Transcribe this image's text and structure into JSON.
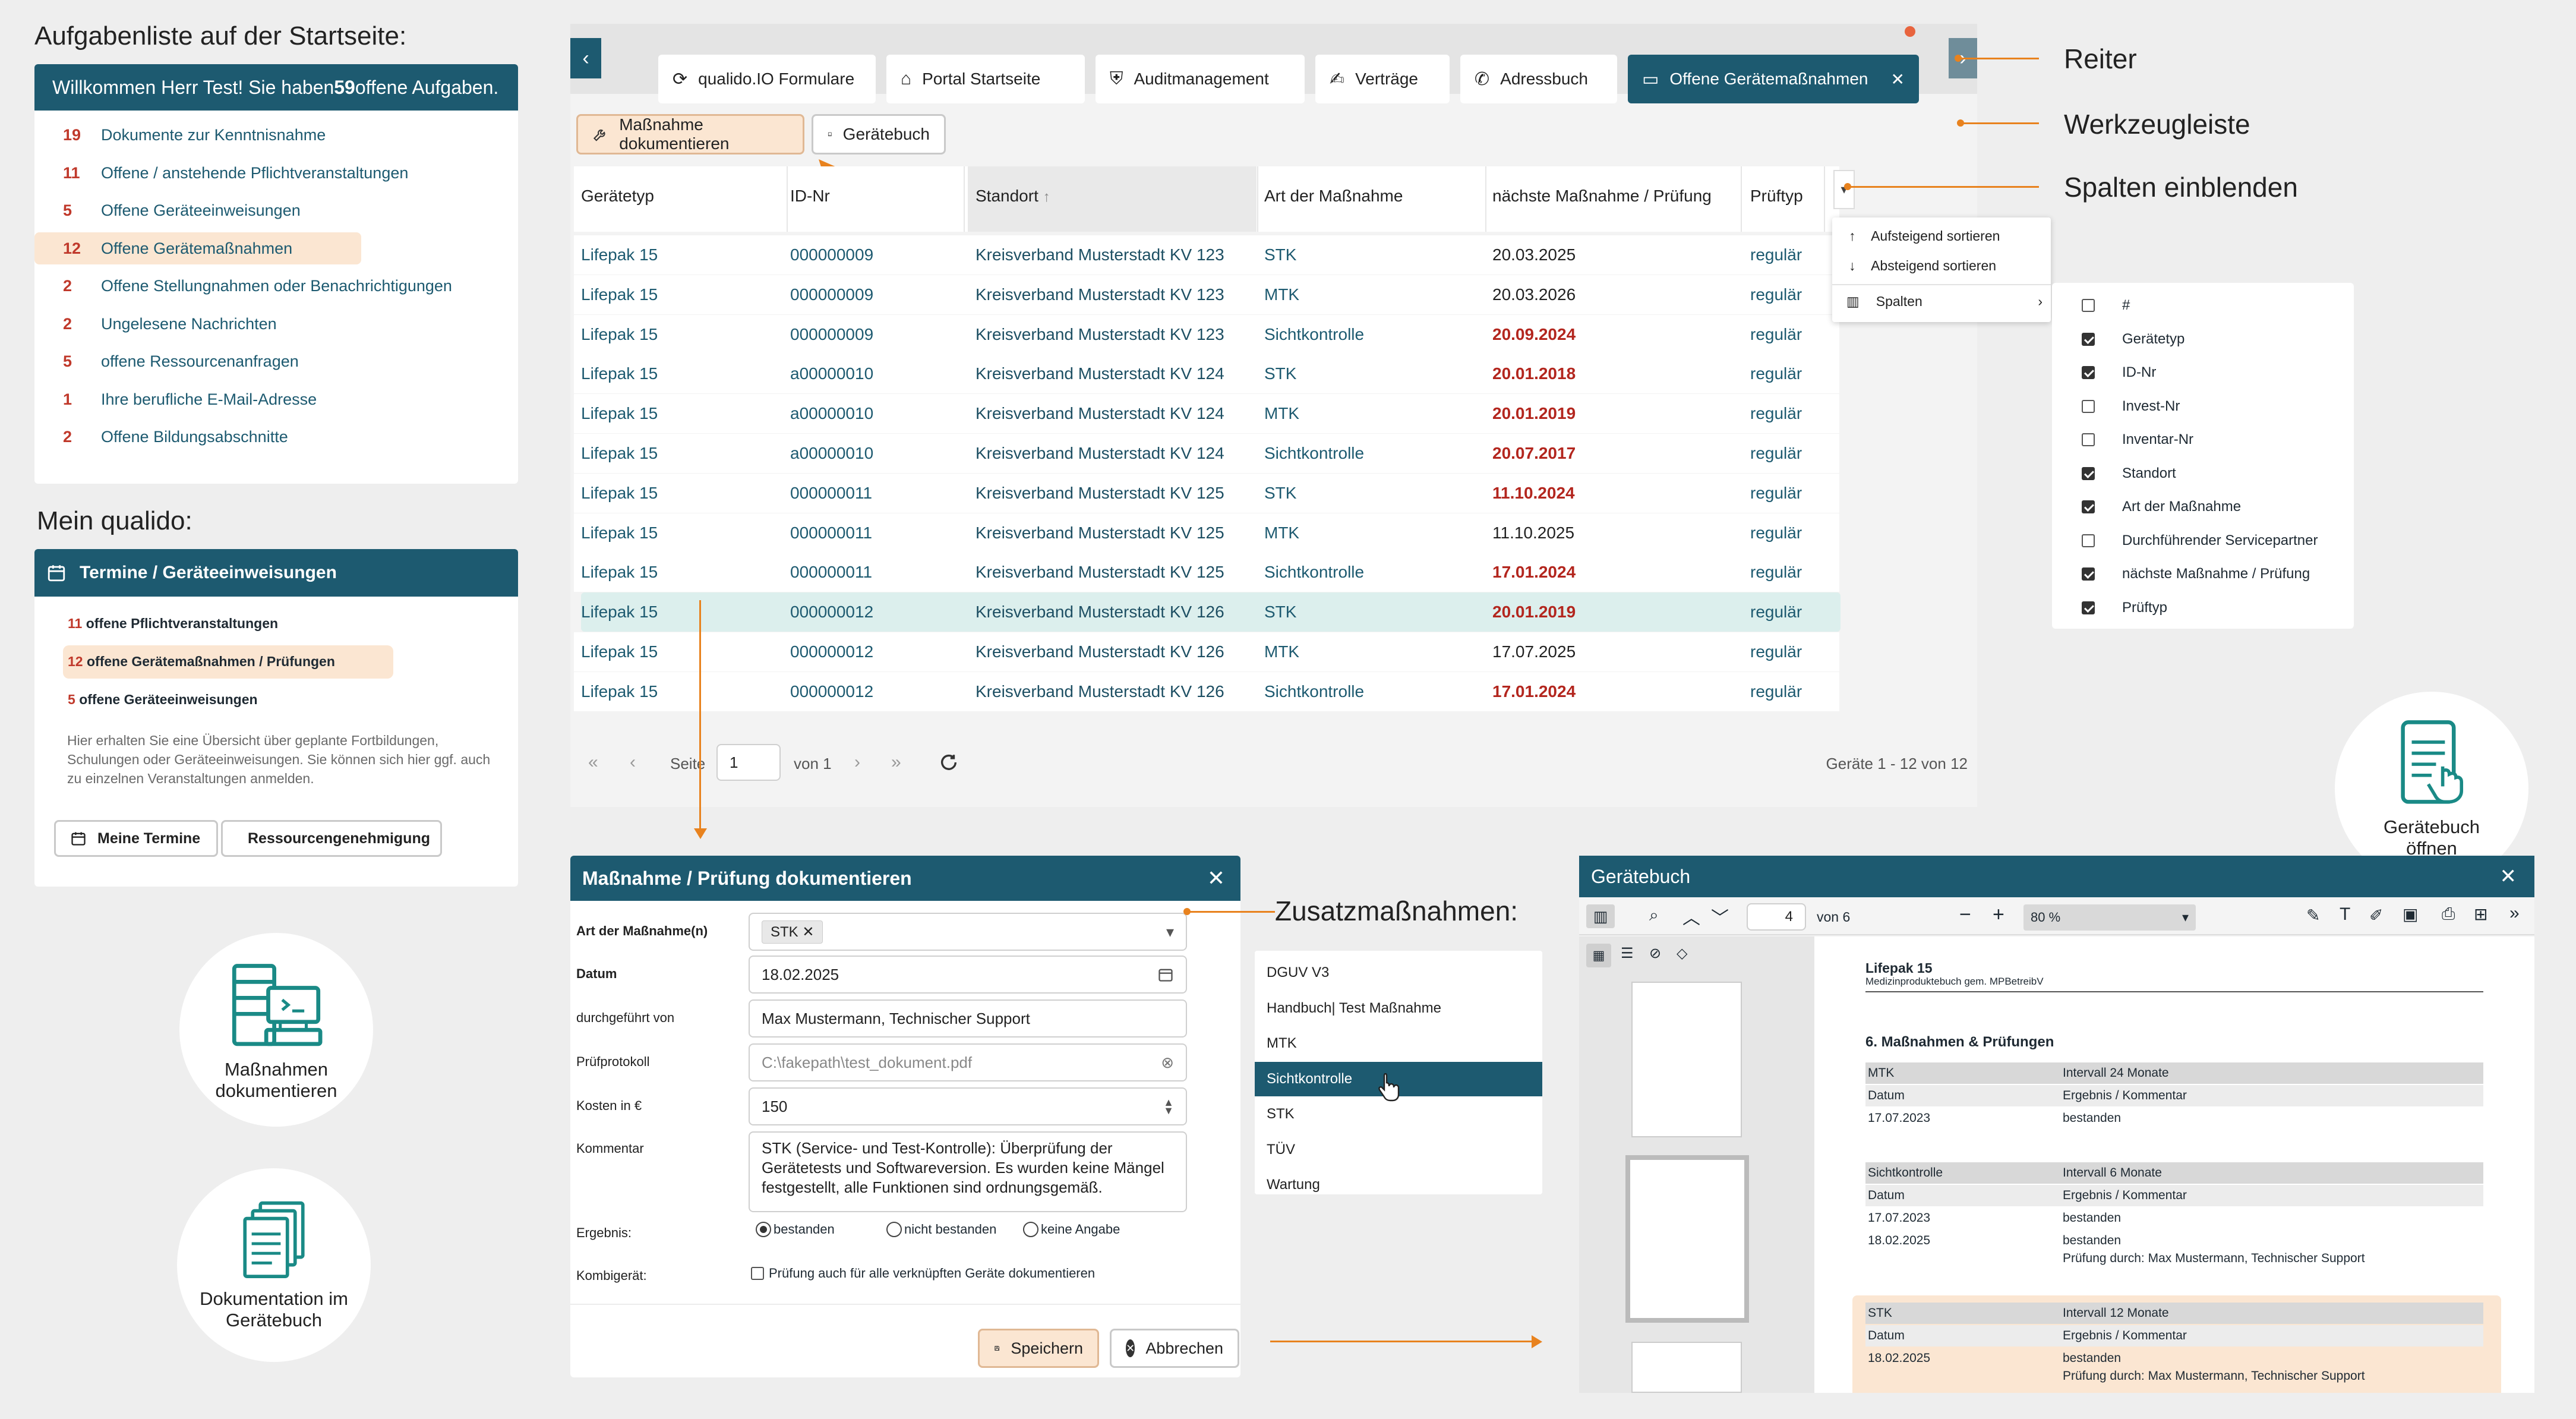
{
  "colors": {
    "teal": "#1d5a70",
    "accent": "#e8821e",
    "highlight": "#fbe6d2",
    "selected_row": "#dcefed",
    "danger": "#b3261e"
  },
  "left_panel": {
    "heading": "Aufgabenliste auf der Startseite:",
    "welcome_prefix": "Willkommen Herr Test! Sie haben ",
    "welcome_count": "59",
    "welcome_suffix": " offene Aufgaben.",
    "tasks": [
      {
        "count": "19",
        "label": "Dokumente zur Kenntnisnahme"
      },
      {
        "count": "11",
        "label": "Offene / anstehende Pflichtveranstaltungen"
      },
      {
        "count": "5",
        "label": "Offene Geräteeinweisungen"
      },
      {
        "count": "12",
        "label": "Offene Gerätemaßnahmen"
      },
      {
        "count": "2",
        "label": "Offene Stellungnahmen oder Benachrichtigungen"
      },
      {
        "count": "2",
        "label": "Ungelesene Nachrichten"
      },
      {
        "count": "5",
        "label": "offene Ressourcenanfragen"
      },
      {
        "count": "1",
        "label": "Ihre berufliche E-Mail-Adresse"
      },
      {
        "count": "2",
        "label": "Offene Bildungsabschnitte"
      }
    ],
    "mein_heading": "Mein qualido:",
    "termine_title": "Termine / Geräteeinweisungen",
    "termine_items": [
      {
        "count": "11",
        "label": "offene Pflichtveranstaltungen"
      },
      {
        "count": "12",
        "label": "offene Gerätemaßnahmen / Prüfungen"
      },
      {
        "count": "5",
        "label": "offene Geräteeinweisungen"
      }
    ],
    "termine_info": "Hier erhalten Sie eine Übersicht über geplante Fortbildungen, Schulungen oder Geräteeinweisungen. Sie können sich hier ggf. auch zu einzelnen Veranstaltungen anmelden.",
    "btn_termine": "Meine Termine",
    "btn_ressourcen": "Ressourcengenehmigung",
    "circle1_l1": "Maßnahmen",
    "circle1_l2": "dokumentieren",
    "circle2_l1": "Dokumentation im",
    "circle2_l2": "Gerätebuch"
  },
  "tabs": [
    {
      "label": "qualido.IO Formulare",
      "icon": "cloud-sync-icon"
    },
    {
      "label": "Portal Startseite",
      "icon": "home-icon"
    },
    {
      "label": "Auditmanagement",
      "icon": "audit-icon"
    },
    {
      "label": "Verträge",
      "icon": "handshake-icon"
    },
    {
      "label": "Adressbuch",
      "icon": "phone-icon"
    },
    {
      "label": "Offene Gerätemaßnahmen",
      "icon": "monitor-icon"
    }
  ],
  "toolbar": {
    "doc_button": "Maßnahme dokumentieren",
    "book_button": "Gerätebuch"
  },
  "table": {
    "headers": [
      "Gerätetyp",
      "ID-Nr",
      "Standort",
      "Art der Maßnahme",
      "nächste Maßnahme / Prüfung",
      "Prüftyp"
    ],
    "rows": [
      {
        "typ": "Lifepak 15",
        "id": "000000009",
        "standort": "Kreisverband Musterstadt KV 123",
        "art": "STK",
        "next": "20.03.2025",
        "overdue": false,
        "pruef": "regulär"
      },
      {
        "typ": "Lifepak 15",
        "id": "000000009",
        "standort": "Kreisverband Musterstadt KV 123",
        "art": "MTK",
        "next": "20.03.2026",
        "overdue": false,
        "pruef": "regulär"
      },
      {
        "typ": "Lifepak 15",
        "id": "000000009",
        "standort": "Kreisverband Musterstadt KV 123",
        "art": "Sichtkontrolle",
        "next": "20.09.2024",
        "overdue": true,
        "pruef": "regulär"
      },
      {
        "typ": "Lifepak 15",
        "id": "a00000010",
        "standort": "Kreisverband Musterstadt KV 124",
        "art": "STK",
        "next": "20.01.2018",
        "overdue": true,
        "pruef": "regulär"
      },
      {
        "typ": "Lifepak 15",
        "id": "a00000010",
        "standort": "Kreisverband Musterstadt KV 124",
        "art": "MTK",
        "next": "20.01.2019",
        "overdue": true,
        "pruef": "regulär"
      },
      {
        "typ": "Lifepak 15",
        "id": "a00000010",
        "standort": "Kreisverband Musterstadt KV 124",
        "art": "Sichtkontrolle",
        "next": "20.07.2017",
        "overdue": true,
        "pruef": "regulär"
      },
      {
        "typ": "Lifepak 15",
        "id": "000000011",
        "standort": "Kreisverband Musterstadt KV 125",
        "art": "STK",
        "next": "11.10.2024",
        "overdue": true,
        "pruef": "regulär"
      },
      {
        "typ": "Lifepak 15",
        "id": "000000011",
        "standort": "Kreisverband Musterstadt KV 125",
        "art": "MTK",
        "next": "11.10.2025",
        "overdue": false,
        "pruef": "regulär"
      },
      {
        "typ": "Lifepak 15",
        "id": "000000011",
        "standort": "Kreisverband Musterstadt KV 125",
        "art": "Sichtkontrolle",
        "next": "17.01.2024",
        "overdue": true,
        "pruef": "regulär"
      },
      {
        "typ": "Lifepak 15",
        "id": "000000012",
        "standort": "Kreisverband Musterstadt KV 126",
        "art": "STK",
        "next": "20.01.2019",
        "overdue": true,
        "pruef": "regulär",
        "selected": true
      },
      {
        "typ": "Lifepak 15",
        "id": "000000012",
        "standort": "Kreisverband Musterstadt KV 126",
        "art": "MTK",
        "next": "17.07.2025",
        "overdue": false,
        "pruef": "regulär"
      },
      {
        "typ": "Lifepak 15",
        "id": "000000012",
        "standort": "Kreisverband Musterstadt KV 126",
        "art": "Sichtkontrolle",
        "next": "17.01.2024",
        "overdue": true,
        "pruef": "regulär"
      }
    ],
    "pager_page_label": "Seite",
    "pager_page": "1",
    "pager_of": "von 1",
    "pager_summary": "Geräte 1 - 12 von 12"
  },
  "column_menu": {
    "asc": "Aufsteigend sortieren",
    "desc": "Absteigend sortieren",
    "columns": "Spalten",
    "items": [
      {
        "label": "#",
        "checked": false
      },
      {
        "label": "Gerätetyp",
        "checked": true
      },
      {
        "label": "ID-Nr",
        "checked": true
      },
      {
        "label": "Invest-Nr",
        "checked": false
      },
      {
        "label": "Inventar-Nr",
        "checked": false
      },
      {
        "label": "Standort",
        "checked": true
      },
      {
        "label": "Art der Maßnahme",
        "checked": true
      },
      {
        "label": "Durchführender Servicepartner",
        "checked": false
      },
      {
        "label": "nächste Maßnahme / Prüfung",
        "checked": true
      },
      {
        "label": "Prüftyp",
        "checked": true
      }
    ]
  },
  "annotations": {
    "reiter": "Reiter",
    "werkzeugleiste": "Werkzeugleiste",
    "spalten": "Spalten einblenden",
    "zusatz": "Zusatzmaßnahmen:",
    "geraetebuch_l1": "Gerätebuch",
    "geraetebuch_l2": "öffnen"
  },
  "dialog": {
    "title": "Maßnahme / Prüfung dokumentieren",
    "labels": {
      "art": "Art der Maßnahme(n)",
      "datum": "Datum",
      "durch": "durchgeführt von",
      "protokoll": "Prüfprotokoll",
      "kosten": "Kosten in €",
      "kommentar": "Kommentar",
      "ergebnis": "Ergebnis:",
      "kombi": "Kombigerät:"
    },
    "art_tag": "STK",
    "datum": "18.02.2025",
    "durch": "Max Mustermann, Technischer Support",
    "protokoll": "C:\\fakepath\\test_dokument.pdf",
    "kosten": "150",
    "kommentar": "STK (Service- und Test-Kontrolle): Überprüfung der Gerätetests und Softwareversion. Es wurden keine Mängel festgestellt, alle Funktionen sind ordnungsgemäß.",
    "result_options": [
      "bestanden",
      "nicht bestanden",
      "keine Angabe"
    ],
    "kombi_text": "Prüfung auch für alle verknüpften Geräte dokumentieren",
    "save": "Speichern",
    "cancel": "Abbrechen"
  },
  "zusatz_list": [
    "DGUV V3",
    "Handbuch| Test Maßnahme",
    "MTK",
    "Sichtkontrolle",
    "STK",
    "TÜV",
    "Wartung"
  ],
  "viewer": {
    "title": "Gerätebuch",
    "page": "4",
    "page_of": "von 6",
    "zoom": "80 %",
    "doc_title": "Lifepak 15",
    "doc_subtitle": "Medizinproduktebuch gem. MPBetreibV",
    "section": "6. Maßnahmen & Prüfungen",
    "blocks": [
      {
        "name": "MTK",
        "interval": "Intervall 24 Monate",
        "col1": "Datum",
        "col2": "Ergebnis / Kommentar",
        "rows": [
          [
            "17.07.2023",
            "bestanden",
            ""
          ]
        ],
        "highlight": false
      },
      {
        "name": "Sichtkontrolle",
        "interval": "Intervall 6 Monate",
        "col1": "Datum",
        "col2": "Ergebnis / Kommentar",
        "rows": [
          [
            "17.07.2023",
            "bestanden",
            ""
          ],
          [
            "18.02.2025",
            "bestanden",
            "Prüfung durch: Max Mustermann, Technischer Support"
          ]
        ],
        "highlight": false
      },
      {
        "name": "STK",
        "interval": "Intervall 12 Monate",
        "col1": "Datum",
        "col2": "Ergebnis / Kommentar",
        "rows": [
          [
            "18.02.2025",
            "bestanden",
            "Prüfung durch: Max Mustermann, Technischer Support"
          ]
        ],
        "highlight": true
      }
    ]
  }
}
